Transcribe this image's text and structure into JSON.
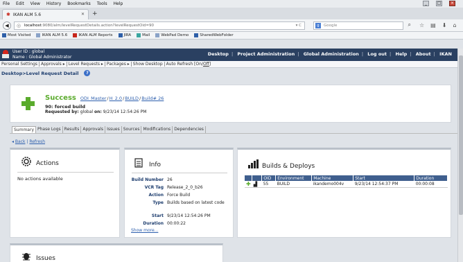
{
  "browser": {
    "menu": [
      "File",
      "Edit",
      "View",
      "History",
      "Bookmarks",
      "Tools",
      "Help"
    ],
    "tab_title": "IKAN ALM 5.6",
    "url_host": "localhost",
    "url_path": ":9080/alm/levelRequestDetails.action?levelRequestOid=90",
    "search_placeholder": "Google",
    "bookmarks": [
      "Most Visited",
      "IKAN ALM 5.6",
      "IKAN ALM Reports",
      "JIRA",
      "Mail",
      "WebPad Demo",
      "SharedWebFolder"
    ]
  },
  "header": {
    "user_id": "User ID : global",
    "user_name": "Name : Global Administrator",
    "nav": [
      "Desktop",
      "Project Administration",
      "Global Administration",
      "Log out",
      "Help",
      "About",
      "IKAN"
    ]
  },
  "submenu": {
    "personal_settings": "Personal Settings",
    "approvals": "Approvals",
    "level_requests": "Level Requests",
    "packages": "Packages",
    "show_desktop": "Show Desktop",
    "auto_refresh": "Auto Refresh [On/",
    "auto_refresh_off": "Off",
    "auto_refresh_end": "]"
  },
  "breadcrumb": "Desktop>Level Request Detail",
  "summary": {
    "status": "Success",
    "links": [
      "ODI_Master",
      "H_2.0",
      "BUILD",
      "Build# 26"
    ],
    "build_line": "90: forced build",
    "requested_label": "Requested by:",
    "requested_by": "global",
    "on_label": "on:",
    "requested_on": "9/23/14 12:54:26 PM"
  },
  "tabs": [
    "Summary",
    "Phase Logs",
    "Results",
    "Approvals",
    "Issues",
    "Sources",
    "Modifications",
    "Dependencies"
  ],
  "back": "Back",
  "refresh": "Refresh",
  "actions": {
    "title": "Actions",
    "empty": "No actions available"
  },
  "info": {
    "title": "Info",
    "rows": [
      {
        "k": "Build Number",
        "v": "26"
      },
      {
        "k": "VCR Tag",
        "v": "Release_2_0_b26"
      },
      {
        "k": "Action",
        "v": "Force Build"
      },
      {
        "k": "Type",
        "v": "Builds based on latest code"
      },
      {
        "k": "Start",
        "v": "9/23/14 12:54:26 PM"
      },
      {
        "k": "Duration",
        "v": "00:00:22"
      }
    ],
    "show_more": "Show more..."
  },
  "builds": {
    "title": "Builds & Deploys",
    "columns": [
      "",
      "",
      "OID",
      "Environment",
      "Machine",
      "Start",
      "Duration"
    ],
    "rows": [
      {
        "oid": "55",
        "environment": "BUILD",
        "machine": "ikandemo004v",
        "start": "9/23/14 12:54:37 PM",
        "duration": "00:00:08"
      }
    ]
  },
  "issues": {
    "title": "Issues"
  },
  "colors": {
    "header_bg": "#2a4061",
    "success_green": "#5aab2c",
    "link_blue": "#2d5fad"
  }
}
